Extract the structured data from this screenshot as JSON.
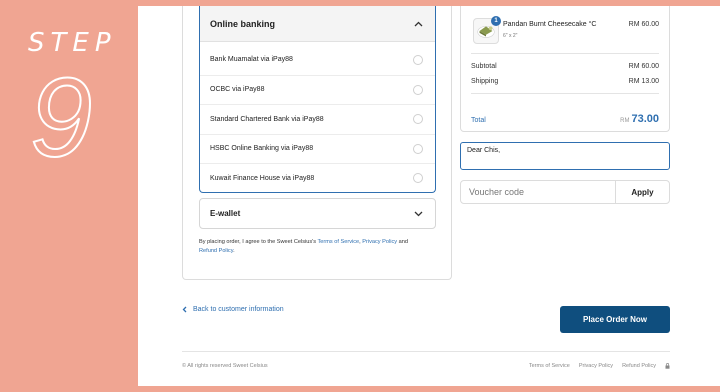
{
  "sidebar": {
    "step_label": "STEP",
    "step_number": "9"
  },
  "payment": {
    "online_banking_label": "Online banking",
    "banks": [
      "Bank Muamalat via iPay88",
      "OCBC via iPay88",
      "Standard Chartered Bank via iPay88",
      "HSBC Online Banking via iPay88",
      "Kuwait Finance House via iPay88"
    ],
    "ewallet_label": "E-wallet",
    "terms_prefix": "By placing order, I agree to the Sweet Celsius's ",
    "terms_of_service": "Terms of Service",
    "terms_comma": ", ",
    "privacy_policy": "Privacy Policy",
    "terms_and": " and",
    "refund_policy": "Refund Policy",
    "terms_end": "."
  },
  "summary": {
    "product": {
      "name": "Pandan Burnt Cheesecake °C",
      "variant": "6\" x 2\"",
      "quantity": "1",
      "price": "RM 60.00"
    },
    "subtotal_label": "Subtotal",
    "subtotal_value": "RM 60.00",
    "shipping_label": "Shipping",
    "shipping_value": "RM 13.00",
    "total_label": "Total",
    "total_currency": "RM",
    "total_value": "73.00"
  },
  "note": {
    "value": "Dear Chis,"
  },
  "voucher": {
    "placeholder": "Voucher code",
    "apply_label": "Apply"
  },
  "nav": {
    "back_label": "Back to customer information",
    "place_order_label": "Place Order Now"
  },
  "footer": {
    "copyright": "© All rights reserved Sweet Celsius",
    "links": [
      "Terms of Service",
      "Privacy Policy",
      "Refund Policy"
    ]
  },
  "colors": {
    "accent": "#2f6fb0",
    "button": "#0f4e7e",
    "background": "#f0a592"
  }
}
